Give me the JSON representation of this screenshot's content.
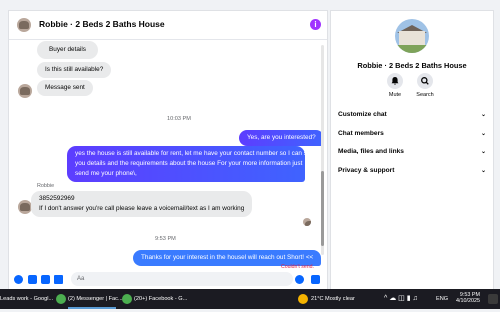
{
  "chat": {
    "title": "Robbie · 2 Beds 2 Baths House",
    "buyer_details_label": "Buyer details",
    "messages": {
      "incoming_1": "Is this still available?",
      "incoming_2": "Message sent",
      "time_1": "10:03 PM",
      "outgoing_1": "Yes, are you interested?",
      "outgoing_2_line1": "yes the house is still available for rent, let me have your contact number so I can send",
      "outgoing_2_line2": "you details and the requirements about the house For  your  more  information  just",
      "outgoing_2_line3": "send  me   your  phone\\,",
      "sender_label": "Robbie",
      "incoming_3_line1": "3852592969",
      "incoming_3_line2": "If I don't answer you're call please leave a voicemail/text as I am working",
      "time_2": "9:53 PM",
      "outgoing_3": "Thanks for your interest in the housel will reach out Short! <<",
      "status": "Couldn't send."
    },
    "composer_placeholder": "Aa",
    "colors": {
      "accent": "#a033ff",
      "outgoing": "#5b3dff",
      "error": "#e41e3f"
    }
  },
  "sidebar": {
    "name": "Robbie · 2 Beds 2 Baths House",
    "actions": [
      {
        "label": "Mute",
        "icon": "bell-icon"
      },
      {
        "label": "Search",
        "icon": "search-icon"
      }
    ],
    "sections": [
      {
        "label": "Customize chat"
      },
      {
        "label": "Chat members"
      },
      {
        "label": "Media, files and links"
      },
      {
        "label": "Privacy & support"
      }
    ]
  },
  "taskbar": {
    "apps": [
      {
        "label": "Leads work - Googl..."
      },
      {
        "label": "(2) Messenger | Fac..."
      },
      {
        "label": "(20+) Facebook - G..."
      }
    ],
    "weather": "21°C  Mostly clear",
    "lang": "ENG",
    "time": "9:53 PM",
    "date": "4/10/2025"
  }
}
